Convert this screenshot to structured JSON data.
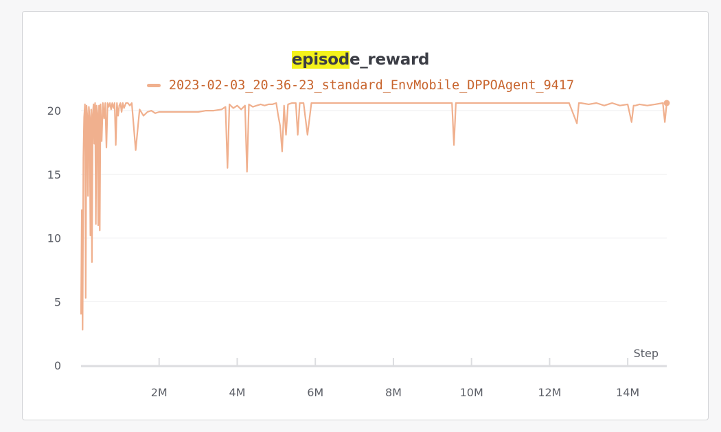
{
  "chart_data": {
    "type": "line",
    "title": "episode_reward",
    "title_highlight": "episod",
    "title_rest": "e_reward",
    "xlabel": "Step",
    "ylabel": "",
    "xlim": [
      0,
      15000000
    ],
    "ylim": [
      0,
      20.6
    ],
    "x_ticks": [
      {
        "value": 2000000,
        "label": "2M"
      },
      {
        "value": 4000000,
        "label": "4M"
      },
      {
        "value": 6000000,
        "label": "6M"
      },
      {
        "value": 8000000,
        "label": "8M"
      },
      {
        "value": 10000000,
        "label": "10M"
      },
      {
        "value": 12000000,
        "label": "12M"
      },
      {
        "value": 14000000,
        "label": "14M"
      }
    ],
    "y_ticks": [
      {
        "value": 0,
        "label": "0"
      },
      {
        "value": 5,
        "label": "5"
      },
      {
        "value": 10,
        "label": "10"
      },
      {
        "value": 15,
        "label": "15"
      },
      {
        "value": 20,
        "label": "20"
      }
    ],
    "grid": true,
    "legend_position": "top-center",
    "series": [
      {
        "name": "2023-02-03_20-36-23_standard_EnvMobile_DPPOAgent_9417",
        "color": "#f0b08e",
        "x": [
          0,
          20000,
          40000,
          60000,
          80000,
          100000,
          120000,
          140000,
          160000,
          180000,
          200000,
          220000,
          240000,
          260000,
          280000,
          300000,
          320000,
          340000,
          360000,
          380000,
          400000,
          420000,
          440000,
          460000,
          480000,
          500000,
          530000,
          560000,
          590000,
          620000,
          650000,
          680000,
          710000,
          740000,
          770000,
          800000,
          830000,
          860000,
          890000,
          920000,
          950000,
          980000,
          1010000,
          1040000,
          1070000,
          1100000,
          1150000,
          1200000,
          1250000,
          1300000,
          1400000,
          1500000,
          1600000,
          1700000,
          1800000,
          1900000,
          2000000,
          2100000,
          2200000,
          2300000,
          2400000,
          2500000,
          2600000,
          2700000,
          2800000,
          3000000,
          3200000,
          3400000,
          3600000,
          3700000,
          3750000,
          3800000,
          3900000,
          4000000,
          4100000,
          4200000,
          4250000,
          4300000,
          4400000,
          4500000,
          4600000,
          4700000,
          4800000,
          4900000,
          5000000,
          5050000,
          5100000,
          5150000,
          5200000,
          5250000,
          5300000,
          5400000,
          5500000,
          5550000,
          5600000,
          5700000,
          5800000,
          5900000,
          6000000,
          6100000,
          6200000,
          6400000,
          6600000,
          6800000,
          7000000,
          7500000,
          8000000,
          8500000,
          9000000,
          9500000,
          9550000,
          9600000,
          10000000,
          10500000,
          11000000,
          11500000,
          12000000,
          12500000,
          12700000,
          12750000,
          12800000,
          13000000,
          13200000,
          13400000,
          13600000,
          13800000,
          14000000,
          14100000,
          14150000,
          14200000,
          14300000,
          14500000,
          14700000,
          14900000,
          14950000,
          15000000
        ],
        "values": [
          4.0,
          12.2,
          2.8,
          16.3,
          19.5,
          20.5,
          5.3,
          20.4,
          19.6,
          13.3,
          20.3,
          19.5,
          10.2,
          20.1,
          8.1,
          19.7,
          20.5,
          17.4,
          20.6,
          11.1,
          20.4,
          19.8,
          11.0,
          20.4,
          10.6,
          20.5,
          17.6,
          20.6,
          19.4,
          20.6,
          17.1,
          20.6,
          20.3,
          20.6,
          20.1,
          20.6,
          20.2,
          20.6,
          17.3,
          20.6,
          19.6,
          20.4,
          20.6,
          19.9,
          20.6,
          20.2,
          20.6,
          20.6,
          20.4,
          20.6,
          16.9,
          20.1,
          19.6,
          19.9,
          20.0,
          19.8,
          19.9,
          19.9,
          19.9,
          19.9,
          19.9,
          19.9,
          19.9,
          19.9,
          19.9,
          19.9,
          20.0,
          20.0,
          20.1,
          20.3,
          15.5,
          20.5,
          20.2,
          20.4,
          20.1,
          20.4,
          15.2,
          20.5,
          20.3,
          20.4,
          20.5,
          20.4,
          20.5,
          20.5,
          20.6,
          19.6,
          18.8,
          16.8,
          20.4,
          18.1,
          20.5,
          20.6,
          20.6,
          18.1,
          20.6,
          20.6,
          18.1,
          20.6,
          20.6,
          20.6,
          20.6,
          20.6,
          20.6,
          20.6,
          20.6,
          20.6,
          20.6,
          20.6,
          20.6,
          20.6,
          17.3,
          20.6,
          20.6,
          20.6,
          20.6,
          20.6,
          20.6,
          20.6,
          19.0,
          20.6,
          20.6,
          20.5,
          20.6,
          20.4,
          20.6,
          20.4,
          20.5,
          19.1,
          20.4,
          20.4,
          20.5,
          20.4,
          20.5,
          20.6,
          19.1,
          20.6
        ]
      }
    ]
  }
}
